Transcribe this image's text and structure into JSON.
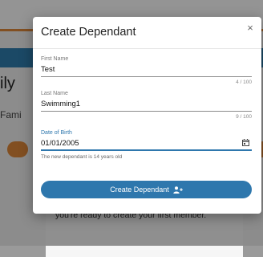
{
  "background": {
    "heading_partial": "ily",
    "subheading_partial": "Fami",
    "info_text": "Interact with the 'Add Dependant' button when you're ready to create your first member."
  },
  "modal": {
    "title": "Create Dependant",
    "close_symbol": "×",
    "first_name": {
      "label": "First Name",
      "value": "Test",
      "counter": "4 / 100"
    },
    "last_name": {
      "label": "Last Name",
      "value": "Swimming1",
      "counter": "9 / 100"
    },
    "dob": {
      "label": "Date of Birth",
      "value": "01/01/2005",
      "hint": "The new dependant is 14 years old",
      "icon": "calendar-icon"
    },
    "submit": {
      "label": "Create Dependant",
      "icon": "add-user-icon"
    }
  },
  "colors": {
    "accent": "#2e77ad",
    "brand_orange": "#e0883a",
    "band_blue": "#2f7fb0"
  }
}
